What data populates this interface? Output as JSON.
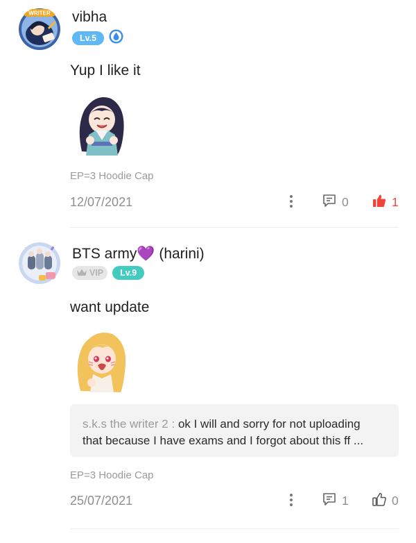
{
  "comments": [
    {
      "username": "vibha",
      "level": "Lv.5",
      "avatar_badge": "WRITER",
      "text": "Yup I like it",
      "sticker": "anime-girl-laughing-sticker",
      "ep": "EP=3 Hoodie Cap",
      "date": "12/07/2021",
      "reply_count": "0",
      "like_count": "1",
      "liked": true
    },
    {
      "username": "BTS army💜 (harini)",
      "vip": "VIP",
      "level": "Lv.9",
      "text": "want update",
      "sticker": "anime-girl-crying-sticker",
      "reply": {
        "author": "s.k.s the writer 2 : ",
        "line1": "ok I will and sorry for not uploading",
        "line2": "that because I have exams and I forgot about this ff ..."
      },
      "ep": "EP=3 Hoodie Cap",
      "date": "25/07/2021",
      "reply_count": "1",
      "like_count": "0",
      "liked": false
    }
  ],
  "colors": {
    "level_blue": "#5fb7f3",
    "level_teal": "#43cbbf",
    "like_red": "#f0453a",
    "muted_text": "#8e8e8e"
  },
  "icons": [
    "more-vertical-icon",
    "comment-icon",
    "thumbs-up-filled-icon",
    "thumbs-up-outline-icon",
    "water-drop-badge-icon",
    "crown-icon"
  ]
}
